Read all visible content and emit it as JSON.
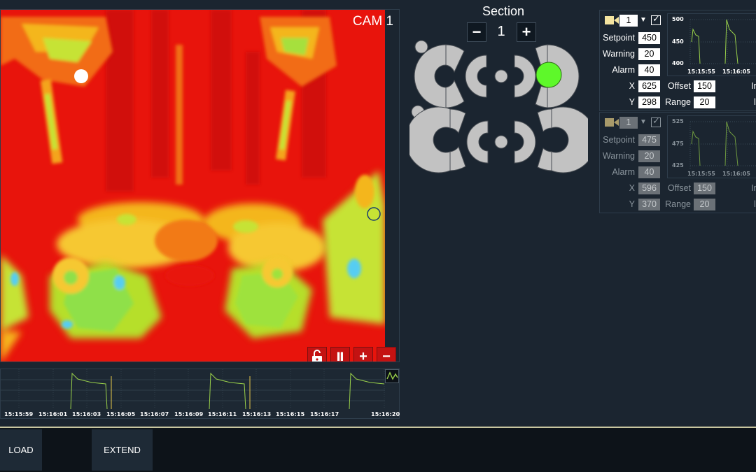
{
  "camera": {
    "title": "CAM 1",
    "lock_icon": "unlock-icon",
    "pause_label": "Ⅱ",
    "zoom_in_label": "+",
    "zoom_out_label": "−"
  },
  "trend": {
    "toggle_icon": "waveform-icon",
    "ticks": [
      "15:15:59",
      "15:16:01",
      "15:16:03",
      "15:16:05",
      "15:16:07",
      "15:16:09",
      "15:16:11",
      "15:16:13",
      "15:16:15",
      "15:16:17",
      "15:16:20"
    ]
  },
  "section": {
    "title": "Section",
    "minus_label": "−",
    "plus_label": "+",
    "value": "1"
  },
  "sensors": [
    {
      "camera_select": "1",
      "checked": "✓",
      "setpoint_label": "Setpoint",
      "setpoint": "450",
      "warning_label": "Warning",
      "warning": "20",
      "alarm_label": "Alarm",
      "alarm": "40",
      "x_label": "X",
      "x": "625",
      "y_label": "Y",
      "y": "298",
      "offset_label": "Offset",
      "offset": "150",
      "range_label": "Range",
      "range": "20",
      "chart_ticks_y": [
        "500",
        "450",
        "400"
      ],
      "chart_ticks_x": [
        "15:15:55",
        "15:16:05"
      ]
    },
    {
      "camera_select": "1",
      "checked": "✓",
      "setpoint_label": "Setpoint",
      "setpoint": "475",
      "warning_label": "Warning",
      "warning": "20",
      "alarm_label": "Alarm",
      "alarm": "40",
      "x_label": "X",
      "x": "596",
      "y_label": "Y",
      "y": "370",
      "offset_label": "Offset",
      "offset": "150",
      "range_label": "Range",
      "range": "20",
      "chart_ticks_y": [
        "525",
        "475",
        "425"
      ],
      "chart_ticks_x": [
        "15:15:55",
        "15:16:05"
      ]
    }
  ],
  "bottom": {
    "load_label": "LOAD",
    "extend_label": "EXTEND"
  },
  "colors": {
    "background": "#1b2530",
    "thermal_hot": "#e8140c",
    "thermal_warm": "#f4c21a",
    "thermal_cool": "#a8e02c",
    "active_indicator": "#5ef82a",
    "trend_line": "#9ad14a",
    "accent_line": "#c8c6a0"
  }
}
